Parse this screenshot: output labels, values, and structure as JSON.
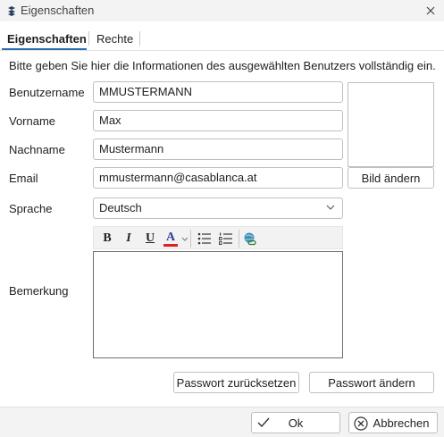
{
  "window": {
    "title": "Eigenschaften"
  },
  "tabs": [
    {
      "label": "Eigenschaften",
      "active": true
    },
    {
      "label": "Rechte",
      "active": false
    }
  ],
  "intro_text": "Bitte geben Sie hier die Informationen des ausgewählten Benutzers vollständig ein.",
  "form": {
    "benutzername": {
      "label": "Benutzername",
      "value": "MMUSTERMANN"
    },
    "vorname": {
      "label": "Vorname",
      "value": "Max"
    },
    "nachname": {
      "label": "Nachname",
      "value": "Mustermann"
    },
    "email": {
      "label": "Email",
      "value": "mmustermann@casablanca.at"
    },
    "sprache": {
      "label": "Sprache",
      "value": "Deutsch"
    },
    "bemerkung": {
      "label": "Bemerkung",
      "value": ""
    }
  },
  "image": {
    "change_label": "Bild ändern"
  },
  "editor_toolbar": {
    "bold": "B",
    "italic": "I",
    "underline": "U",
    "font_color": "A",
    "font_color_value": "#e02020",
    "icons": [
      "bold-icon",
      "italic-icon",
      "underline-icon",
      "font-color-icon",
      "chevron-down-icon",
      "bullet-list-icon",
      "numbered-list-icon",
      "insert-link-icon"
    ]
  },
  "buttons": {
    "reset_password": "Passwort zurücksetzen",
    "change_password": "Passwort ändern",
    "ok": "Ok",
    "cancel": "Abbrechen"
  },
  "colors": {
    "accent": "#2b6cb0",
    "titlebar_bg": "#f3f3f3",
    "border": "#bfbfbf"
  }
}
